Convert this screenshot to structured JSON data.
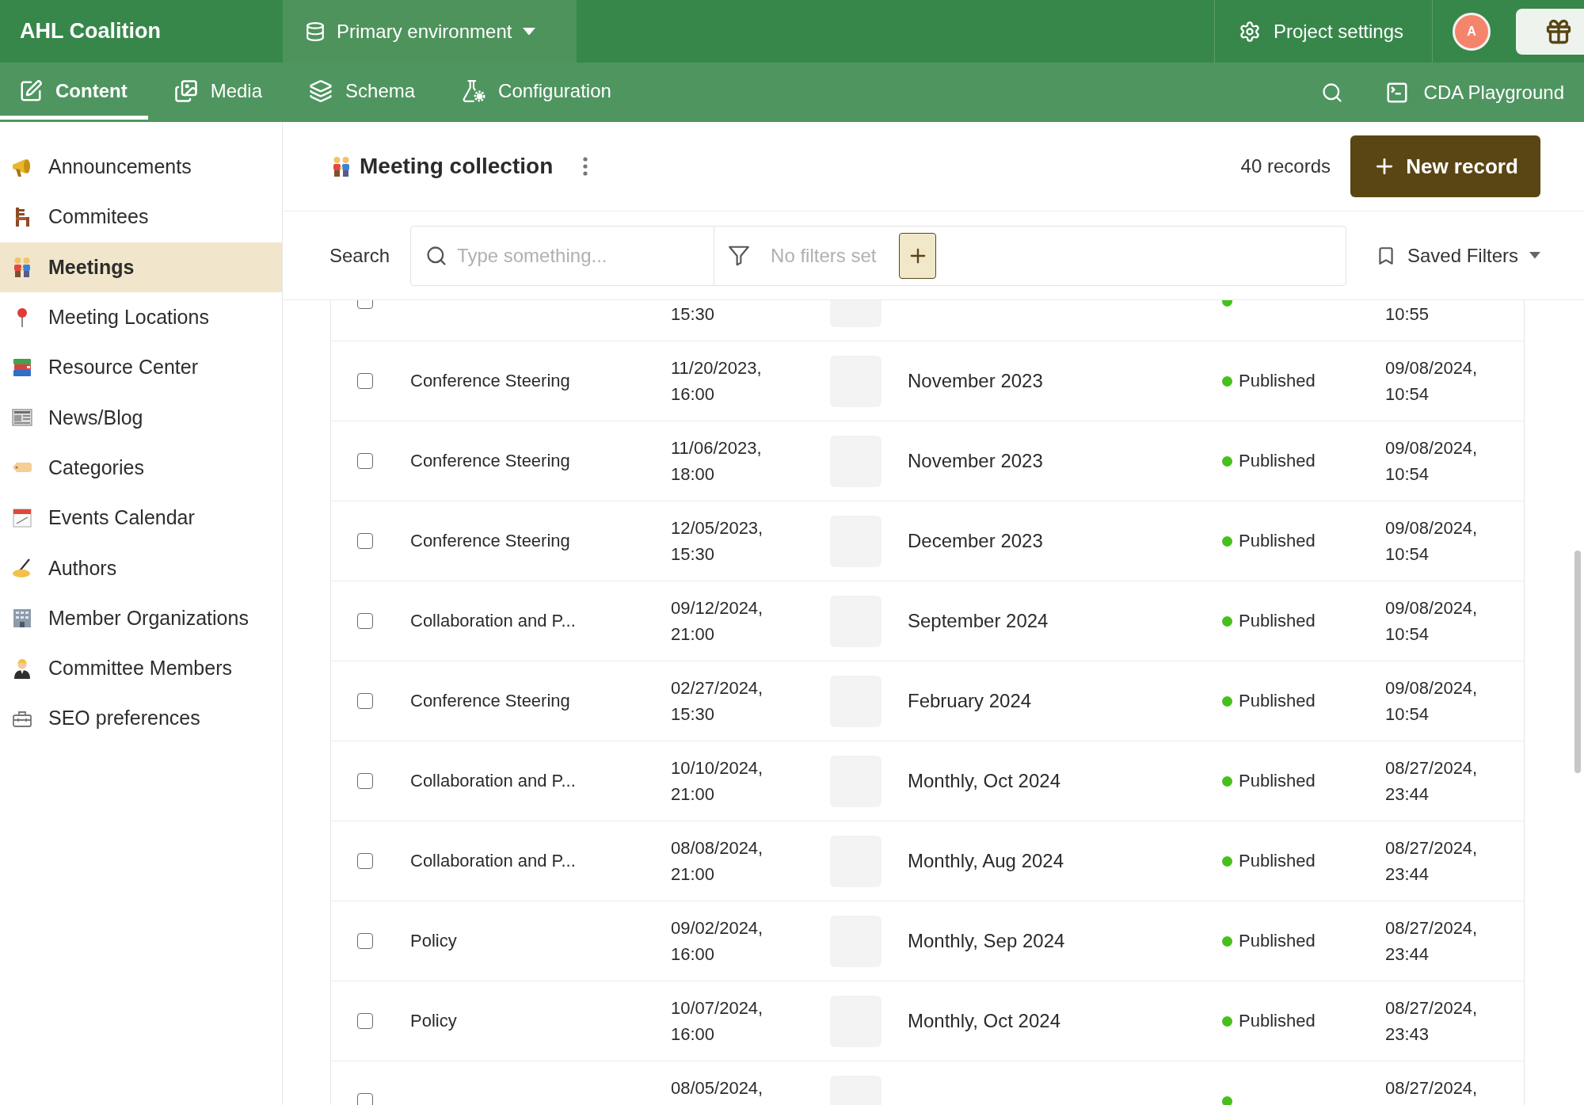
{
  "header": {
    "brand": "AHL Coalition",
    "environment": "Primary environment",
    "settings": "Project settings",
    "avatar": "A"
  },
  "nav": {
    "tabs": [
      {
        "label": "Content",
        "selected": true
      },
      {
        "label": "Media",
        "selected": false
      },
      {
        "label": "Schema",
        "selected": false
      },
      {
        "label": "Configuration",
        "selected": false
      }
    ],
    "playground": "CDA Playground"
  },
  "sidebar": {
    "items": [
      {
        "label": "Announcements",
        "selected": false
      },
      {
        "label": "Commitees",
        "selected": false
      },
      {
        "label": "Meetings",
        "selected": true
      },
      {
        "label": "Meeting Locations",
        "selected": false
      },
      {
        "label": "Resource Center",
        "selected": false
      },
      {
        "label": "News/Blog",
        "selected": false
      },
      {
        "label": "Categories",
        "selected": false
      },
      {
        "label": "Events Calendar",
        "selected": false
      },
      {
        "label": "Authors",
        "selected": false
      },
      {
        "label": "Member Organizations",
        "selected": false
      },
      {
        "label": "Committee Members",
        "selected": false
      },
      {
        "label": "SEO preferences",
        "selected": false
      }
    ]
  },
  "collection": {
    "title": "Meeting collection",
    "count": "40 records",
    "new_button": "New record"
  },
  "filters": {
    "label": "Search",
    "placeholder": "Type something...",
    "filter_status": "No filters set",
    "saved_filters": "Saved Filters"
  },
  "table": {
    "rows": [
      {
        "checked": false,
        "time": "15:30",
        "updated_time": "10:55"
      },
      {
        "checked": false,
        "title": "Conference Steering",
        "date": "11/20/2023,",
        "time": "16:00",
        "month": "November 2023",
        "status": "Published",
        "updated_date": "09/08/2024,",
        "updated_time": "10:54"
      },
      {
        "checked": false,
        "title": "Conference Steering",
        "date": "11/06/2023,",
        "time": "18:00",
        "month": "November 2023",
        "status": "Published",
        "updated_date": "09/08/2024,",
        "updated_time": "10:54"
      },
      {
        "checked": false,
        "title": "Conference Steering",
        "date": "12/05/2023,",
        "time": "15:30",
        "month": "December 2023",
        "status": "Published",
        "updated_date": "09/08/2024,",
        "updated_time": "10:54"
      },
      {
        "checked": false,
        "title": "Collaboration and P...",
        "date": "09/12/2024,",
        "time": "21:00",
        "month": "September 2024",
        "status": "Published",
        "updated_date": "09/08/2024,",
        "updated_time": "10:54"
      },
      {
        "checked": false,
        "title": "Conference Steering",
        "date": "02/27/2024,",
        "time": "15:30",
        "month": "February 2024",
        "status": "Published",
        "updated_date": "09/08/2024,",
        "updated_time": "10:54"
      },
      {
        "checked": false,
        "title": "Collaboration and P...",
        "date": "10/10/2024,",
        "time": "21:00",
        "month": "Monthly, Oct 2024",
        "status": "Published",
        "updated_date": "08/27/2024,",
        "updated_time": "23:44"
      },
      {
        "checked": false,
        "title": "Collaboration and P...",
        "date": "08/08/2024,",
        "time": "21:00",
        "month": "Monthly, Aug 2024",
        "status": "Published",
        "updated_date": "08/27/2024,",
        "updated_time": "23:44"
      },
      {
        "checked": false,
        "title": "Policy",
        "date": "09/02/2024,",
        "time": "16:00",
        "month": "Monthly, Sep 2024",
        "status": "Published",
        "updated_date": "08/27/2024,",
        "updated_time": "23:44"
      },
      {
        "checked": false,
        "title": "Policy",
        "date": "10/07/2024,",
        "time": "16:00",
        "month": "Monthly, Oct 2024",
        "status": "Published",
        "updated_date": "08/27/2024,",
        "updated_time": "23:43"
      },
      {
        "checked": false,
        "date": "08/05/2024,",
        "updated_date": "08/27/2024,"
      }
    ]
  }
}
